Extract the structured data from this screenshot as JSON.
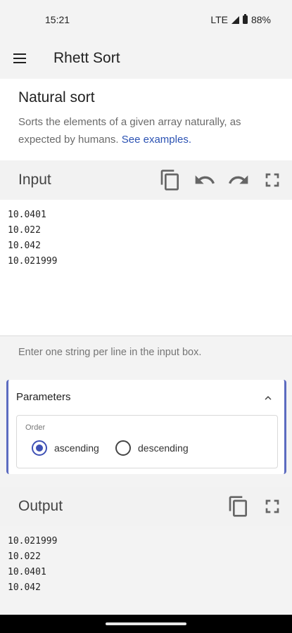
{
  "status_bar": {
    "time": "15:21",
    "network": "LTE",
    "battery": "88%"
  },
  "app_bar": {
    "title": "Rhett Sort",
    "menu_icon": "hamburger-menu-icon"
  },
  "intro": {
    "title": "Natural sort",
    "description": "Sorts the elements of a given array naturally, as expected by humans. ",
    "link": "See examples."
  },
  "input": {
    "title": "Input",
    "icons": [
      "copy-icon",
      "undo-icon",
      "redo-icon",
      "fullscreen-icon"
    ],
    "lines": [
      "10.0401",
      "10.022",
      "10.042",
      "10.021999"
    ],
    "hint": "Enter one string per line in the input box."
  },
  "parameters": {
    "title": "Parameters",
    "order_label": "Order",
    "options": [
      {
        "label": "ascending",
        "selected": true
      },
      {
        "label": "descending",
        "selected": false
      }
    ]
  },
  "output": {
    "title": "Output",
    "icons": [
      "copy-icon",
      "fullscreen-icon"
    ],
    "lines": [
      "10.021999",
      "10.022",
      "10.0401",
      "10.042"
    ]
  },
  "colors": {
    "accent": "#3f51b5",
    "link": "#2b52b3",
    "panel": "#f3f3f3"
  }
}
